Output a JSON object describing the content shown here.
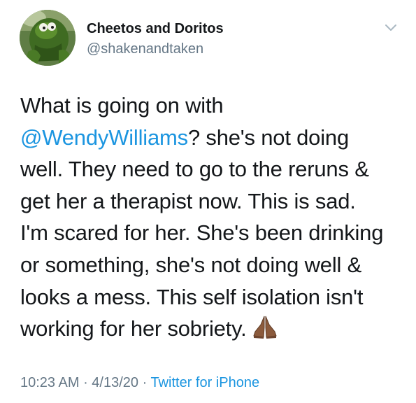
{
  "author": {
    "display_name": "Cheetos and Doritos",
    "handle": "@shakenandtaken",
    "avatar_icon": "kermit-frog-avatar"
  },
  "menu": {
    "icon": "chevron-down-icon"
  },
  "tweet": {
    "lines": [
      {
        "before": "What is going on with",
        "mention": "",
        "after": ""
      },
      {
        "before": "",
        "mention": "@WendyWilliams",
        "after": "? she's not doing"
      },
      {
        "before": "well. They need to go to the reruns &",
        "mention": "",
        "after": ""
      },
      {
        "before": "get her a therapist now.  This is sad.",
        "mention": "",
        "after": ""
      },
      {
        "before": "I'm scared for her. She's been drinking",
        "mention": "",
        "after": ""
      },
      {
        "before": "or something, she's not doing well &",
        "mention": "",
        "after": ""
      },
      {
        "before": "looks a mess.  This self isolation isn't",
        "mention": "",
        "after": ""
      },
      {
        "before": "working for her sobriety.",
        "mention": "",
        "after": ""
      }
    ],
    "emoji": "folded-hands-emoji"
  },
  "meta": {
    "time": "10:23 AM",
    "separator": " · ",
    "date": "4/13/20",
    "source": "Twitter for iPhone"
  },
  "colors": {
    "link": "#1b95e0",
    "secondary": "#657786",
    "text": "#14171a"
  }
}
